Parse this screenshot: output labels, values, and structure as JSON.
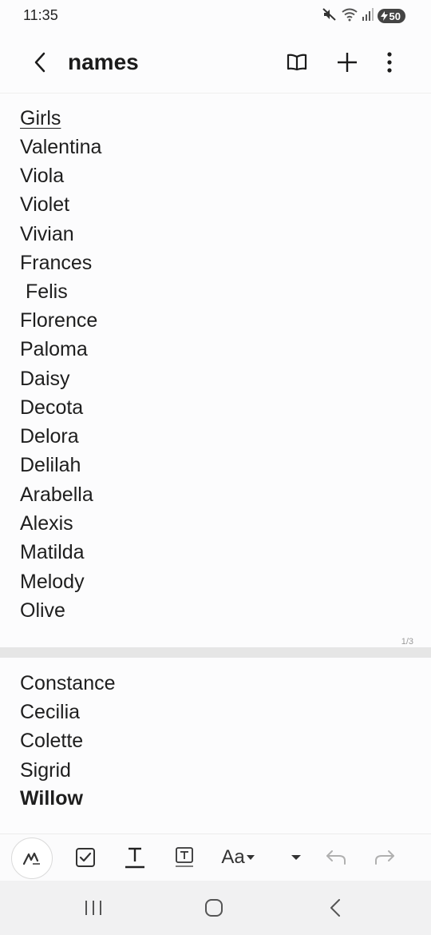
{
  "status_bar": {
    "time": "11:35",
    "battery_level": "50",
    "icons": [
      "mute-icon",
      "wifi-icon",
      "signal-icon",
      "battery-charging-icon"
    ]
  },
  "app_bar": {
    "title": "names",
    "buttons": [
      "back-icon",
      "reading-mode-icon",
      "add-icon",
      "more-icon"
    ]
  },
  "note": {
    "page1": {
      "heading": "Girls",
      "names": [
        "Valentina",
        "Viola",
        "Violet",
        "Vivian",
        "Frances",
        " Felis",
        "Florence",
        "Paloma",
        "Daisy",
        "Decota",
        "Delora",
        "Delilah",
        "Arabella",
        "Alexis",
        "Matilda",
        "Melody",
        "Olive"
      ],
      "page_indicator": "1/3"
    },
    "page2": {
      "names": [
        "Constance",
        "Cecilia",
        "Colette",
        "Sigrid"
      ],
      "bold_name": "Willow"
    }
  },
  "bottom_toolbar": {
    "text_style_label": "Aa",
    "tools": [
      "pen-icon",
      "checkbox-icon",
      "text-format-icon",
      "text-box-icon",
      "text-style-icon",
      "dropdown-icon",
      "undo-icon",
      "redo-icon"
    ]
  },
  "nav_bar": {
    "buttons": [
      "recents-icon",
      "home-icon",
      "back-icon"
    ]
  }
}
